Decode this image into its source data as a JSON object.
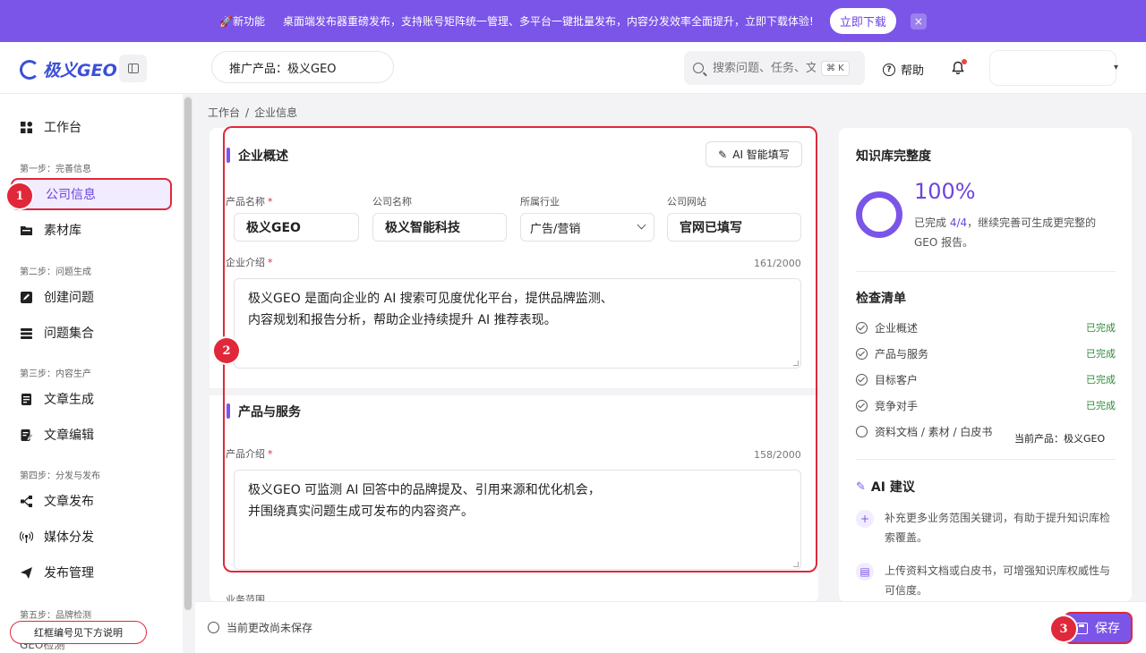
{
  "announcement": {
    "tag": "🚀新功能",
    "text": "桌面端发布器重磅发布，支持账号矩阵统一管理、多平台一键批量发布，内容分发效率全面提升，立即下载体验!",
    "download_label": "立即下载",
    "close_label": "×"
  },
  "header": {
    "logo_text": "极义GEO",
    "product_pill": "推广产品：极义GEO",
    "search_placeholder": "搜索问题、任务、文",
    "search_shortcut": "⌘ K",
    "help_label": "帮助"
  },
  "sidebar": {
    "workbench": "工作台",
    "step1": "第一步：完善信息",
    "company_info": "公司信息",
    "materials": "素材库",
    "step2": "第二步：问题生成",
    "create_question": "创建问题",
    "question_set": "问题集合",
    "step3": "第三步：内容生产",
    "article_gen": "文章生成",
    "article_edit": "文章编辑",
    "step4": "第四步：分发与发布",
    "article_publish": "文章发布",
    "media_dist": "媒体分发",
    "publish_mgmt": "发布管理",
    "step5": "第五步：品牌检测",
    "last_item": "GEO检测"
  },
  "breadcrumb": [
    "工作台",
    "/",
    "企业信息"
  ],
  "main": {
    "overview_title": "企业概述",
    "ai_fill_label": "AI 智能填写",
    "fields": {
      "product_name_label": "产品名称",
      "product_name": "极义GEO",
      "company_name_label": "公司名称",
      "company_name": "极义智能科技",
      "industry_label": "所属行业",
      "industry": "广告/营销",
      "website_label": "公司网站",
      "website": "官网已填写"
    },
    "intro_label": "企业介绍",
    "intro_count": "161/2000",
    "intro_line1": "极义GEO 是面向企业的 AI 搜索可见度优化平台，提供品牌监测、",
    "intro_line2": "内容规划和报告分析，帮助企业持续提升 AI 推荐表现。",
    "products_title": "产品与服务",
    "product_intro_label": "产品介绍",
    "product_intro_count": "158/2000",
    "product_intro_line1": "极义GEO 可监测 AI 回答中的品牌提及、引用来源和优化机会，",
    "product_intro_line2": "并围绕真实问题生成可发布的内容资产。",
    "business_scope_label": "业务范围",
    "required_mark": "*"
  },
  "right_panel": {
    "completeness_title": "知识库完整度",
    "percent": "100%",
    "desc_prefix": "已完成 ",
    "desc_count": "4/4",
    "desc_suffix": "，继续完善可生成更完整的 GEO 报告。",
    "checklist_title": "检查清单",
    "checklist": [
      {
        "label": "企业概述",
        "status": "已完成"
      },
      {
        "label": "产品与服务",
        "status": "已完成"
      },
      {
        "label": "目标客户",
        "status": "已完成"
      },
      {
        "label": "竞争对手",
        "status": "已完成"
      },
      {
        "label": "资料文档 / 素材 / 白皮书",
        "status": ""
      }
    ],
    "current_product_tip": "当前产品：极义GEO",
    "ai_suggest_title": "AI 建议",
    "suggestions": [
      "补充更多业务范围关键词，有助于提升知识库检索覆盖。",
      "上传资料文档或白皮书，可增强知识库权威性与可信度。"
    ]
  },
  "bottom": {
    "unsaved_text": "当前更改尚未保存",
    "save_label": "保存"
  },
  "annotations": {
    "badge1": "1",
    "badge2": "2",
    "badge3": "3",
    "note": "红框编号见下方说明"
  },
  "colors": {
    "accent": "#7b55e8",
    "highlight_red": "#e0283a",
    "done_green": "#2e8b3a"
  }
}
